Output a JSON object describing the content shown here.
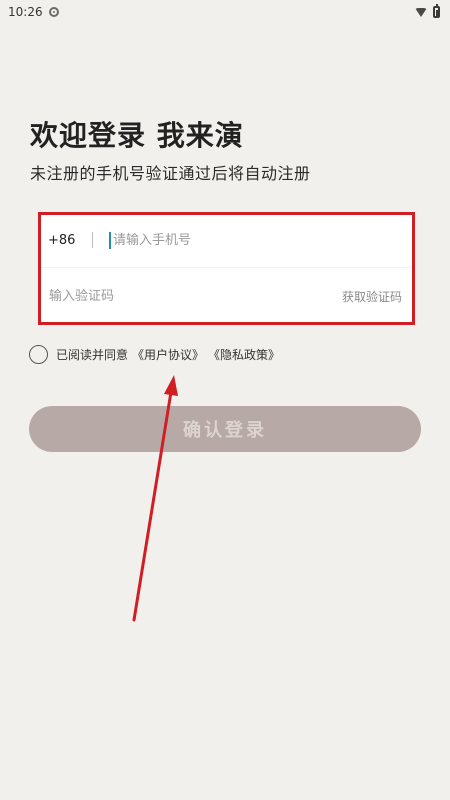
{
  "status_bar": {
    "time": "10:26",
    "icons": [
      "settings-icon",
      "wifi-icon",
      "battery-icon"
    ]
  },
  "header": {
    "title": "欢迎登录 我来演",
    "subtitle": "未注册的手机号验证通过后将自动注册"
  },
  "form": {
    "country_code": "+86",
    "phone_placeholder": "请输入手机号",
    "phone_value": "",
    "code_placeholder": "输入验证码",
    "code_value": "",
    "get_code_label": "获取验证码"
  },
  "agreement": {
    "text": "已阅读并同意",
    "user_agreement": "《用户协议》",
    "privacy_policy": "《隐私政策》",
    "checked": false
  },
  "login_button": {
    "label": "确认登录",
    "enabled": false
  },
  "annotations": {
    "highlight_color": "#d01e24",
    "arrow_color": "#d01e24"
  },
  "colors": {
    "background": "#f2f0ec",
    "button_disabled": "#b7aaa6",
    "cursor": "#2a8f9a"
  }
}
